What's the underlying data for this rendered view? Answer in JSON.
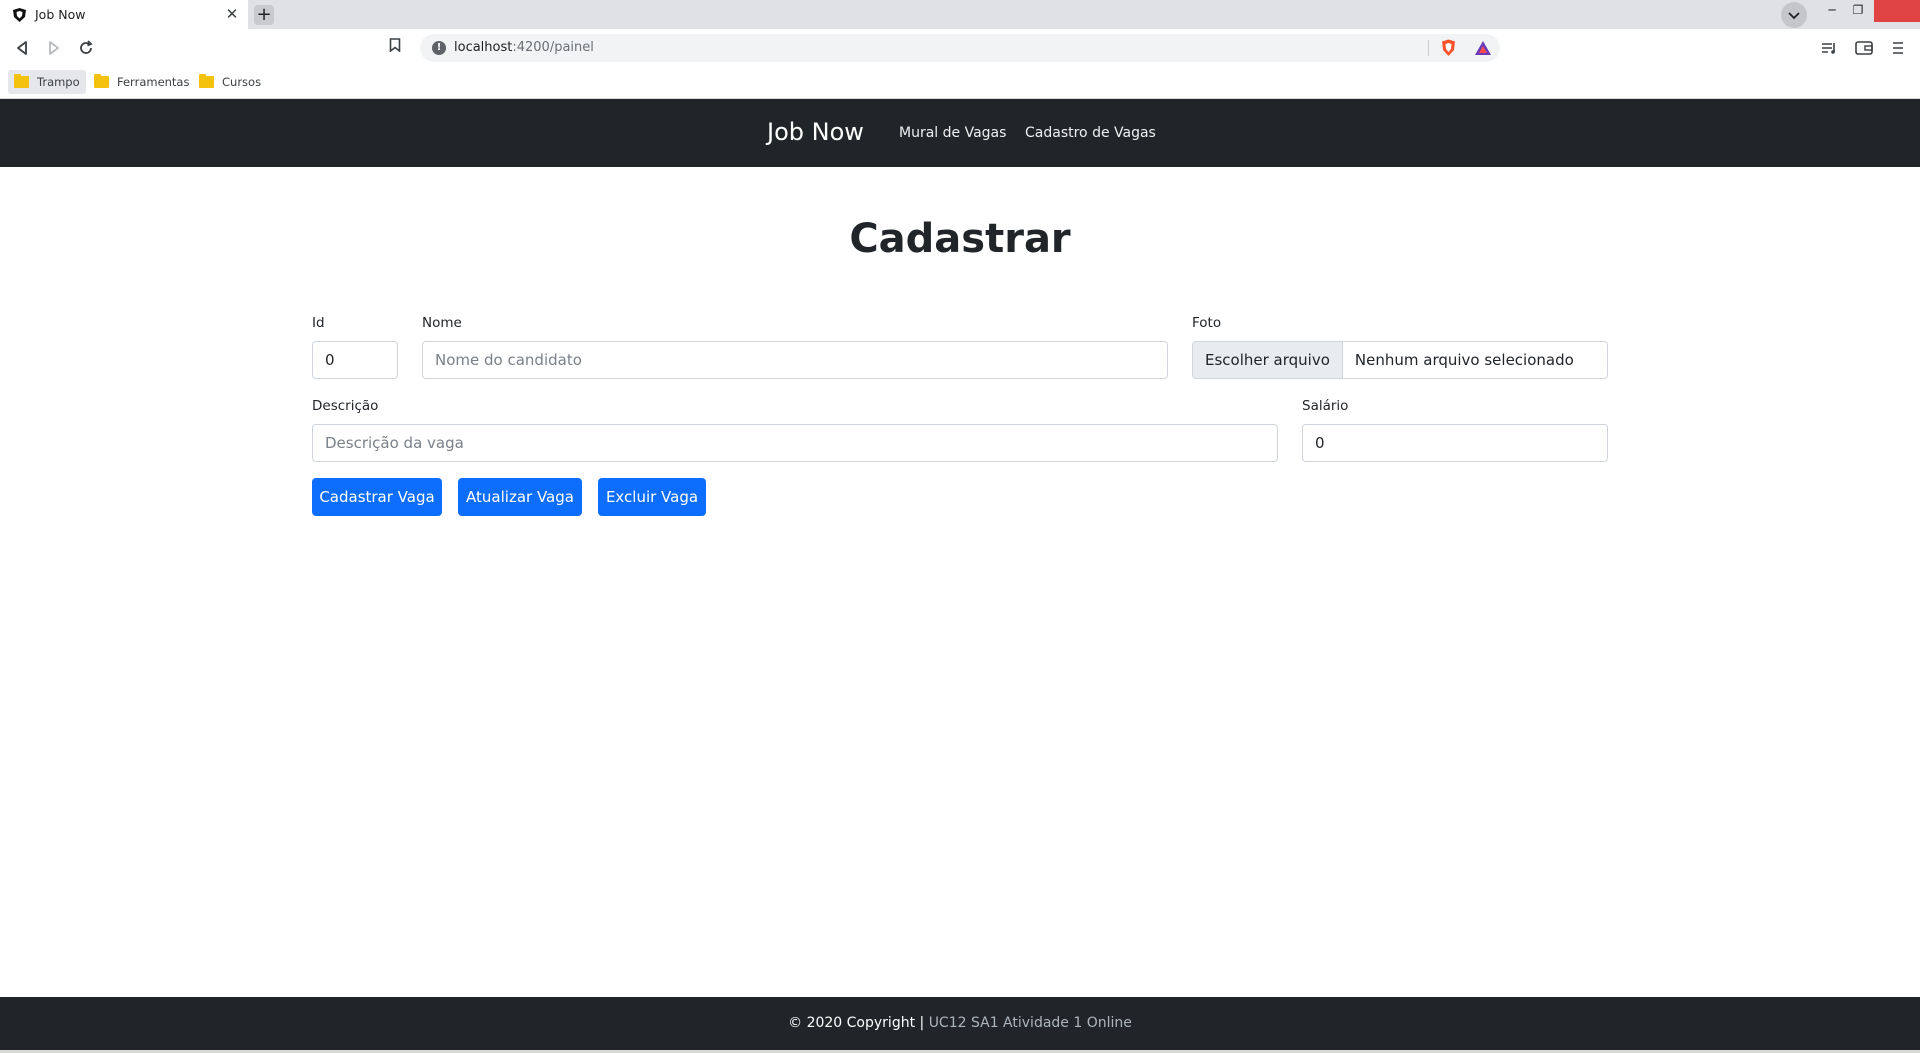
{
  "browser": {
    "tab_title": "Job Now",
    "url_host": "localhost",
    "url_path": ":4200/painel",
    "bookmarks": [
      "Trampo",
      "Ferramentas",
      "Cursos"
    ]
  },
  "nav": {
    "brand": "Job Now",
    "links": [
      "Mural de Vagas",
      "Cadastro de Vagas"
    ]
  },
  "form": {
    "title": "Cadastrar",
    "id_label": "Id",
    "id_value": "0",
    "nome_label": "Nome",
    "nome_placeholder": "Nome do candidato",
    "foto_label": "Foto",
    "foto_button": "Escolher arquivo",
    "foto_status": "Nenhum arquivo selecionado",
    "descricao_label": "Descrição",
    "descricao_placeholder": "Descrição da vaga",
    "salario_label": "Salário",
    "salario_value": "0",
    "buttons": {
      "cadastrar": "Cadastrar Vaga",
      "atualizar": "Atualizar Vaga",
      "excluir": "Excluir Vaga"
    }
  },
  "footer": {
    "copyright": "© 2020 Copyright | ",
    "link": "UC12 SA1 Atividade 1 Online"
  },
  "colors": {
    "navbar_bg": "#212529",
    "primary_button": "#0d6efd",
    "window_close": "#e04343"
  }
}
